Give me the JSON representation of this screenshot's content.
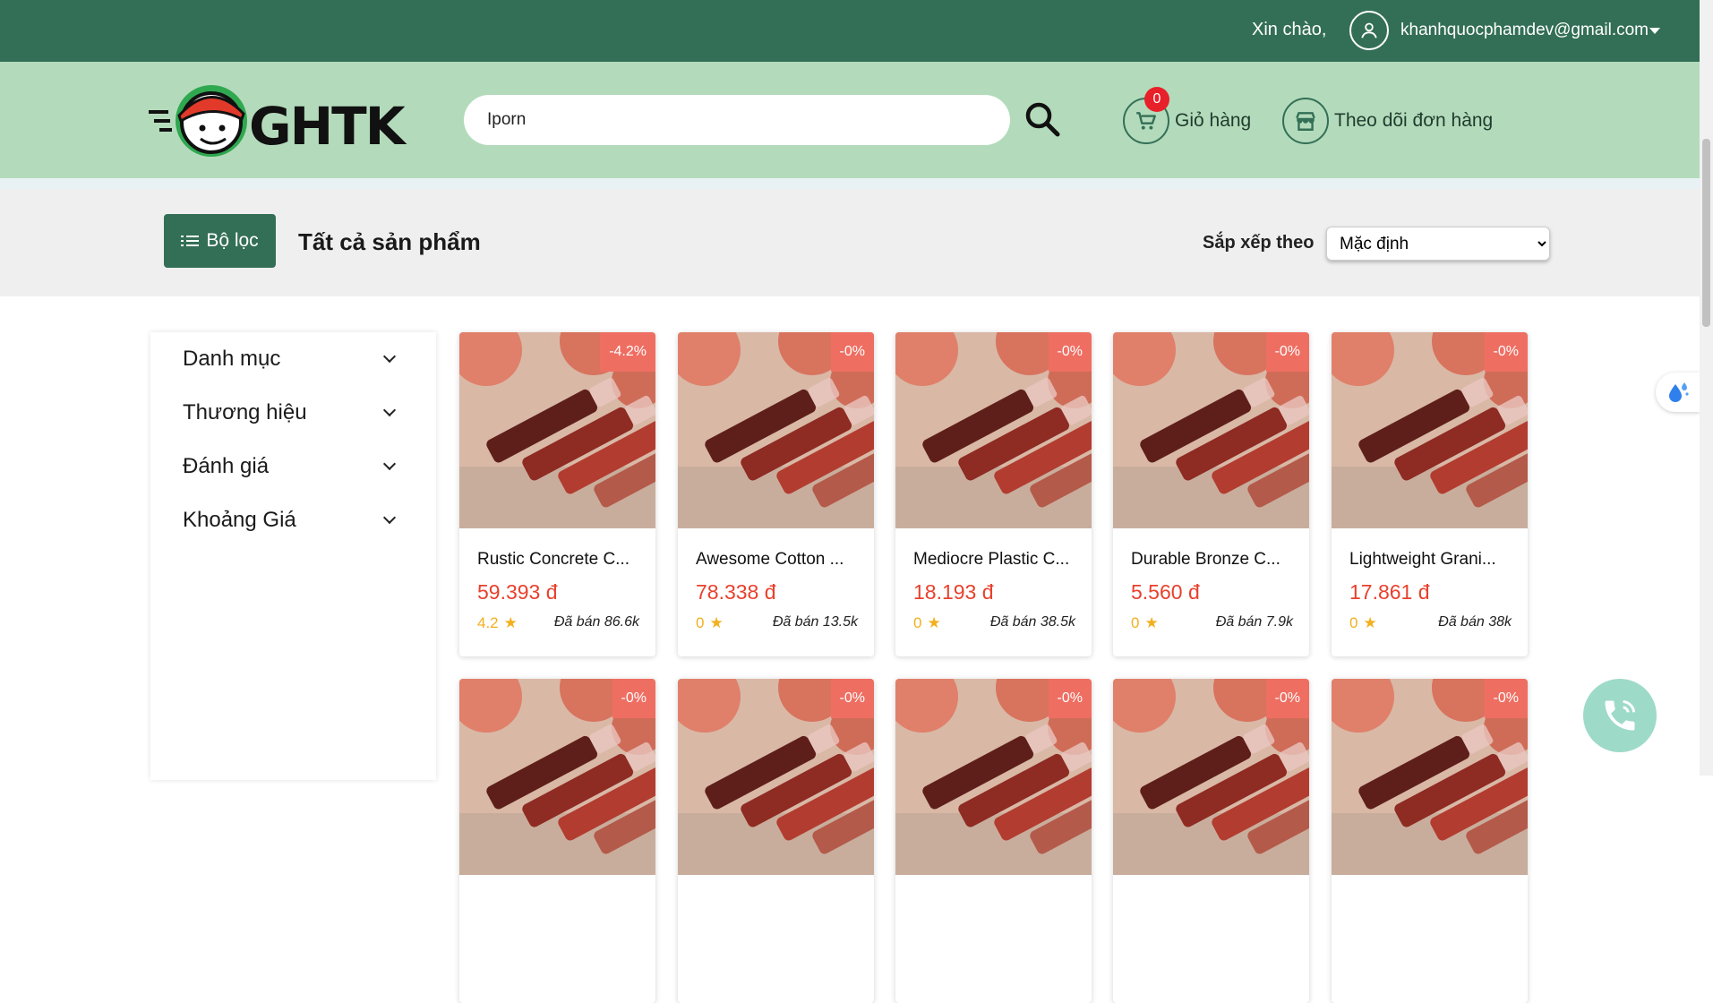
{
  "topbar": {
    "greeting": "Xin chào,",
    "email": "khanhquocphamdev@gmail.com"
  },
  "header": {
    "logo_text": "GHTK",
    "search_value": "Iporn",
    "cart": {
      "count": "0",
      "label": "Giỏ hàng"
    },
    "track_label": "Theo dõi đơn hàng"
  },
  "toolbar": {
    "filter_label": "Bộ lọc",
    "title": "Tất cả sản phẩm",
    "sort_label": "Sắp xếp theo",
    "sort_value": "Mặc định"
  },
  "sidebar": {
    "filters": [
      "Danh mục",
      "Thương hiệu",
      "Đánh giá",
      "Khoảng Giá"
    ]
  },
  "products": [
    {
      "name": "Rustic Concrete C...",
      "price": "59.393 đ",
      "rating": "4.2",
      "sold": "Đã bán 86.6k",
      "discount": "-4.2%"
    },
    {
      "name": "Awesome Cotton ...",
      "price": "78.338 đ",
      "rating": "0",
      "sold": "Đã bán 13.5k",
      "discount": "-0%"
    },
    {
      "name": "Mediocre Plastic C...",
      "price": "18.193 đ",
      "rating": "0",
      "sold": "Đã bán 38.5k",
      "discount": "-0%"
    },
    {
      "name": "Durable Bronze C...",
      "price": "5.560 đ",
      "rating": "0",
      "sold": "Đã bán 7.9k",
      "discount": "-0%"
    },
    {
      "name": "Lightweight Grani...",
      "price": "17.861 đ",
      "rating": "0",
      "sold": "Đã bán 38k",
      "discount": "-0%"
    }
  ],
  "products_row2": [
    {
      "discount": "-0%"
    },
    {
      "discount": "-0%"
    },
    {
      "discount": "-0%"
    },
    {
      "discount": "-0%"
    },
    {
      "discount": "-0%"
    }
  ],
  "colors": {
    "primary": "#336f56",
    "header_bg": "#b3dbbb",
    "price": "#e8412d",
    "discount": "#ef6e62",
    "star": "#f2b01e"
  }
}
